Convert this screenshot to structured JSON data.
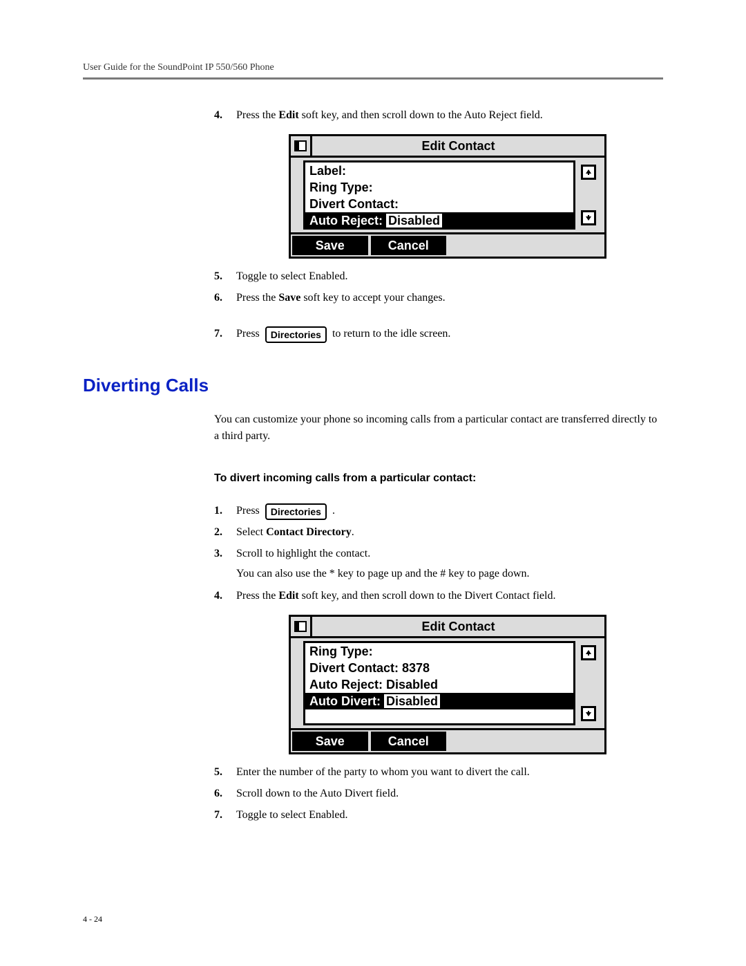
{
  "header": "User Guide for the SoundPoint IP 550/560 Phone",
  "page_number": "4 - 24",
  "button_directories": "Directories",
  "section1": {
    "step4": {
      "num": "4.",
      "pre": "Press the ",
      "bold": "Edit",
      "post": " soft key, and then scroll down to the Auto Reject field."
    },
    "step5": {
      "num": "5.",
      "text": "Toggle to select Enabled."
    },
    "step6": {
      "num": "6.",
      "pre": "Press the ",
      "bold": "Save",
      "post": " soft key to accept your changes."
    },
    "step7": {
      "num": "7.",
      "pre": "Press ",
      "post": " to return to the idle screen."
    }
  },
  "lcd1": {
    "title": "Edit Contact",
    "rows": {
      "r0": "Label:",
      "r1": "Ring Type:",
      "r2": "Divert Contact:",
      "r3_label": "Auto Reject: ",
      "r3_value": "Disabled"
    },
    "soft": {
      "k0": "Save",
      "k1": "Cancel"
    }
  },
  "heading": "Diverting Calls",
  "intro": "You can customize your phone so incoming calls from a particular contact are transferred directly to a third party.",
  "subheading": "To divert incoming calls from a particular contact:",
  "section2": {
    "step1": {
      "num": "1.",
      "pre": "Press ",
      "post": " ."
    },
    "step2": {
      "num": "2.",
      "pre": "Select ",
      "bold": "Contact Directory",
      "post": "."
    },
    "step3": {
      "num": "3.",
      "text": "Scroll to highlight the contact.",
      "sub": "You can also use the * key to page up and the # key to page down."
    },
    "step4": {
      "num": "4.",
      "pre": "Press the ",
      "bold": "Edit",
      "post": " soft key, and then scroll down to the Divert Contact field."
    },
    "step5": {
      "num": "5.",
      "text": "Enter the number of the party to whom you want to divert the call."
    },
    "step6": {
      "num": "6.",
      "text": "Scroll down to the Auto Divert field."
    },
    "step7": {
      "num": "7.",
      "text": "Toggle to select Enabled."
    }
  },
  "lcd2": {
    "title": "Edit Contact",
    "rows": {
      "r0": "Ring Type:",
      "r1": "Divert Contact: 8378",
      "r2": "Auto Reject: Disabled",
      "r3_label": "Auto Divert: ",
      "r3_value": "Disabled"
    },
    "soft": {
      "k0": "Save",
      "k1": "Cancel"
    }
  }
}
